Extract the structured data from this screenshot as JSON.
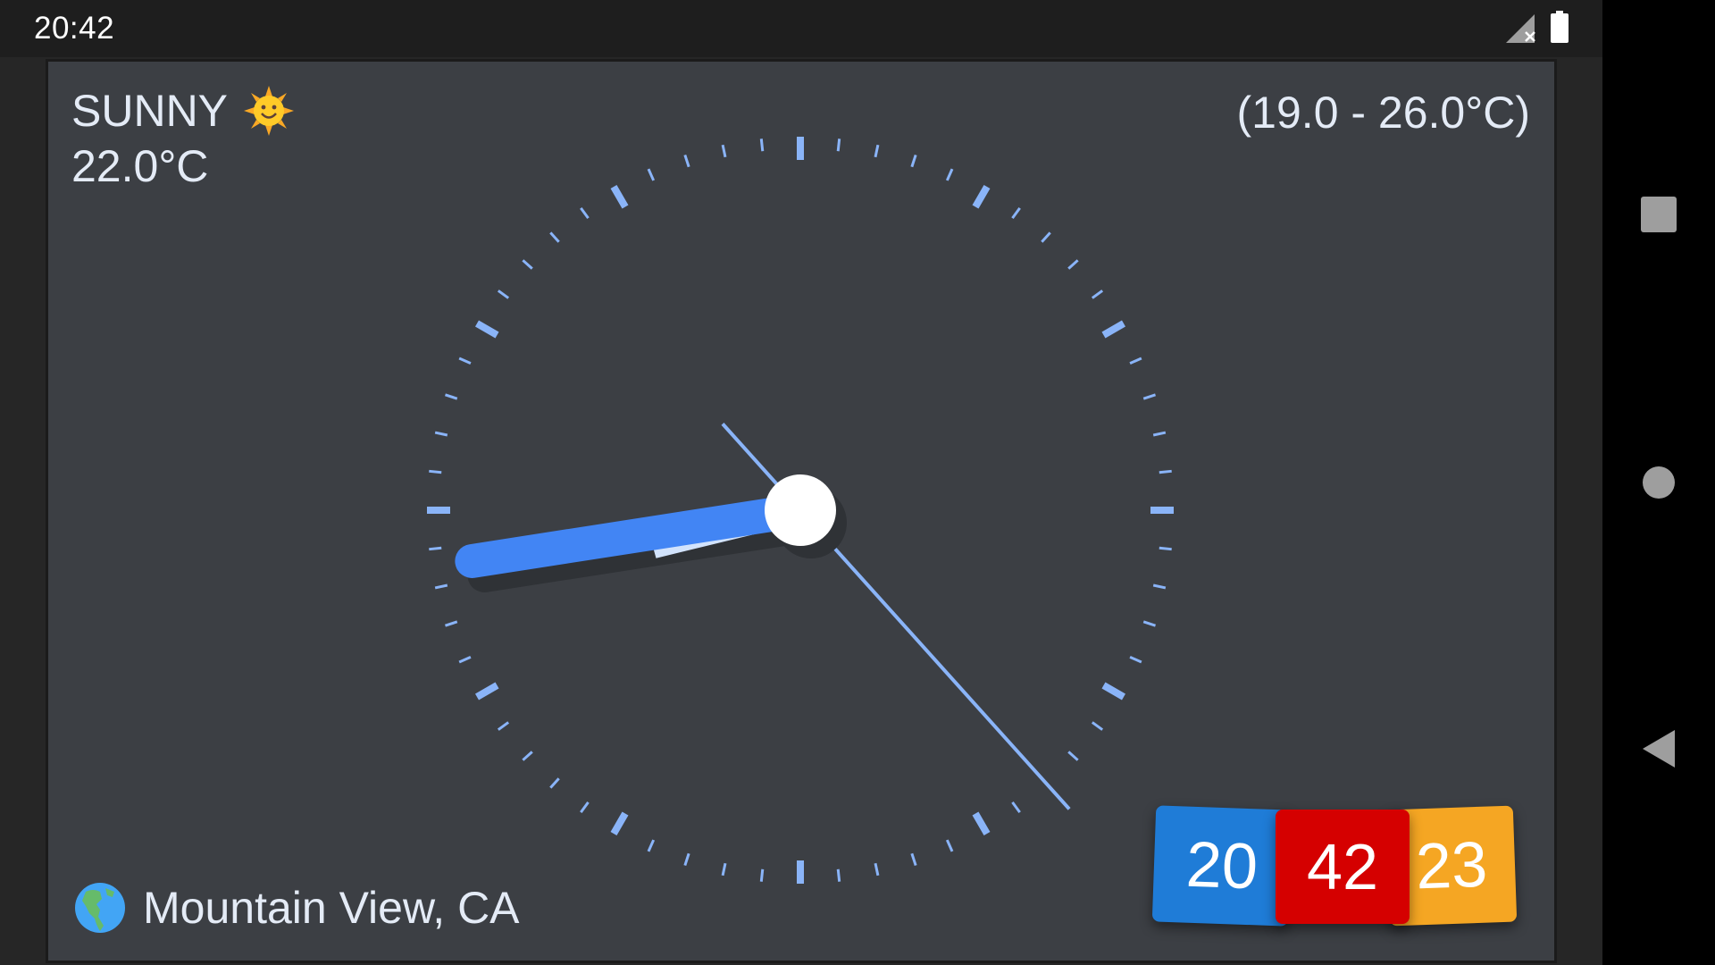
{
  "status_bar": {
    "time": "20:42",
    "signal_icon": "signal-no-data-icon",
    "battery_icon": "battery-full-icon"
  },
  "weather": {
    "condition": "SUNNY",
    "condition_icon": "sun-face-icon",
    "temperature": "22.0°C",
    "range": "(19.0 - 26.0°C)"
  },
  "location": {
    "icon": "globe-americas-icon",
    "name": "Mountain View, CA"
  },
  "clock": {
    "hours": 20,
    "minutes": 42,
    "seconds": 23,
    "hand_color": "#4285f4",
    "tick_color": "#8ab4f8"
  },
  "digital": {
    "hours": "20",
    "minutes": "42",
    "seconds": "23",
    "hours_color": "#1f7cd7",
    "minutes_color": "#d50000",
    "seconds_color": "#f5a623"
  },
  "navigation": {
    "recents_icon": "square-recents-icon",
    "home_icon": "circle-home-icon",
    "back_icon": "triangle-back-icon"
  }
}
